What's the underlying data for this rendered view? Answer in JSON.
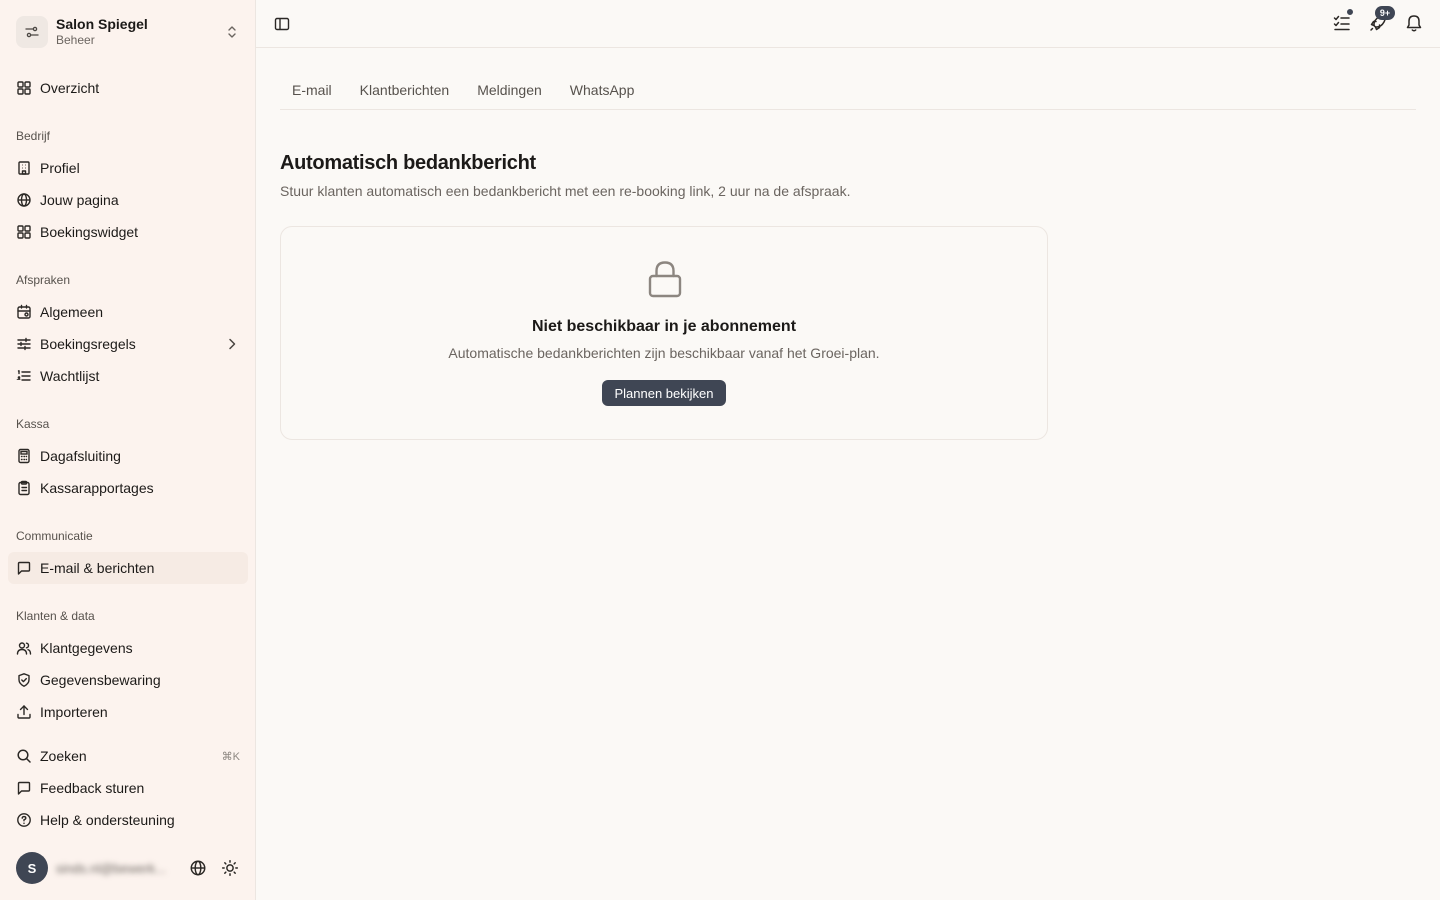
{
  "workspace": {
    "name": "Salon Spiegel",
    "role": "Beheer"
  },
  "nav": {
    "overview": "Overzicht",
    "sections": {
      "company": "Bedrijf",
      "appointments": "Afspraken",
      "register": "Kassa",
      "communication": "Communicatie",
      "clients": "Klanten & data"
    },
    "items": {
      "profile": "Profiel",
      "your_page": "Jouw pagina",
      "booking_widget": "Boekingswidget",
      "general": "Algemeen",
      "booking_rules": "Boekingsregels",
      "waitlist": "Wachtlijst",
      "day_closing": "Dagafsluiting",
      "register_reports": "Kassarapportages",
      "email_messages": "E-mail & berichten",
      "client_data": "Klantgegevens",
      "data_retention": "Gegevensbewaring",
      "import": "Importeren"
    },
    "footer": {
      "search": "Zoeken",
      "search_shortcut": "⌘K",
      "feedback": "Feedback sturen",
      "help": "Help & ondersteuning"
    }
  },
  "user": {
    "initial": "S",
    "email": "sinds.nl@bewerk..."
  },
  "topbar": {
    "badge": "9+"
  },
  "tabs": [
    "E-mail",
    "Klantberichten",
    "Meldingen",
    "WhatsApp"
  ],
  "main": {
    "title": "Automatisch bedankbericht",
    "description": "Stuur klanten automatisch een bedankbericht met een re-booking link, 2 uur na de afspraak.",
    "locked": {
      "title": "Niet beschikbaar in je abonnement",
      "description": "Automatische bedankberichten zijn beschikbaar vanaf het Groei-plan.",
      "button": "Plannen bekijken"
    }
  },
  "colors": {
    "sidebar_bg": "#fcf3ee",
    "primary": "#3f4654",
    "page_bg": "#fbf9f6"
  }
}
